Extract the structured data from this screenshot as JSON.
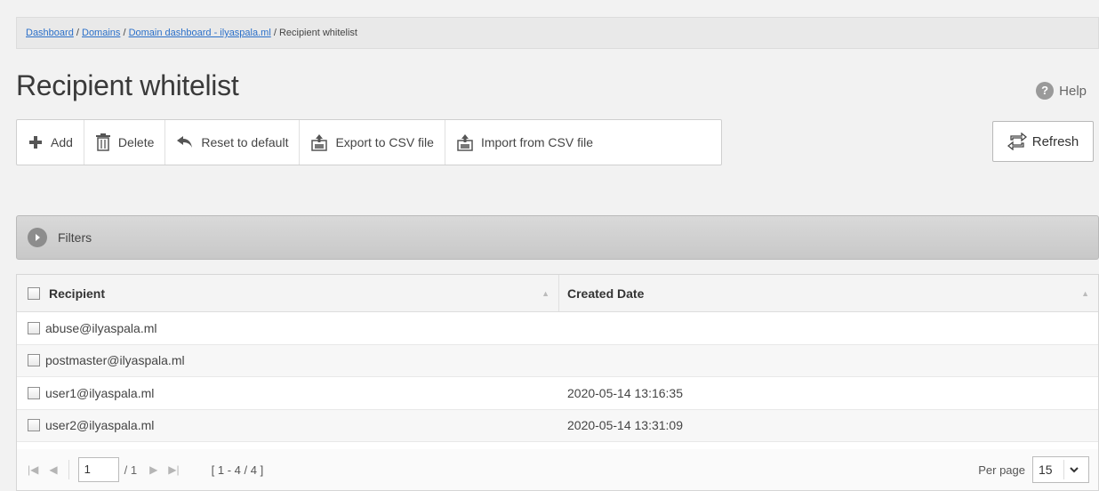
{
  "breadcrumb": {
    "items": [
      "Dashboard",
      "Domains",
      "Domain dashboard - ilyaspala.ml"
    ],
    "current": "Recipient whitelist",
    "separator": " / "
  },
  "page": {
    "title": "Recipient whitelist",
    "help": "Help"
  },
  "toolbar": {
    "add": "Add",
    "delete": "Delete",
    "reset": "Reset to default",
    "export": "Export to CSV file",
    "import": "Import from CSV file",
    "refresh": "Refresh"
  },
  "filters": {
    "label": "Filters"
  },
  "table": {
    "columns": [
      "Recipient",
      "Created Date"
    ],
    "rows": [
      {
        "recipient": "abuse@ilyaspala.ml",
        "created": ""
      },
      {
        "recipient": "postmaster@ilyaspala.ml",
        "created": ""
      },
      {
        "recipient": "user1@ilyaspala.ml",
        "created": "2020-05-14 13:16:35"
      },
      {
        "recipient": "user2@ilyaspala.ml",
        "created": "2020-05-14 13:31:09"
      }
    ]
  },
  "pager": {
    "page": "1",
    "of": "/ 1",
    "range": "[ 1 - 4 / 4 ]",
    "per_page_label": "Per page",
    "per_page_value": "15"
  },
  "colors": {
    "link": "#2a6fc9",
    "add_icon": "#555555",
    "filters_bar": "#c8c8c8"
  }
}
